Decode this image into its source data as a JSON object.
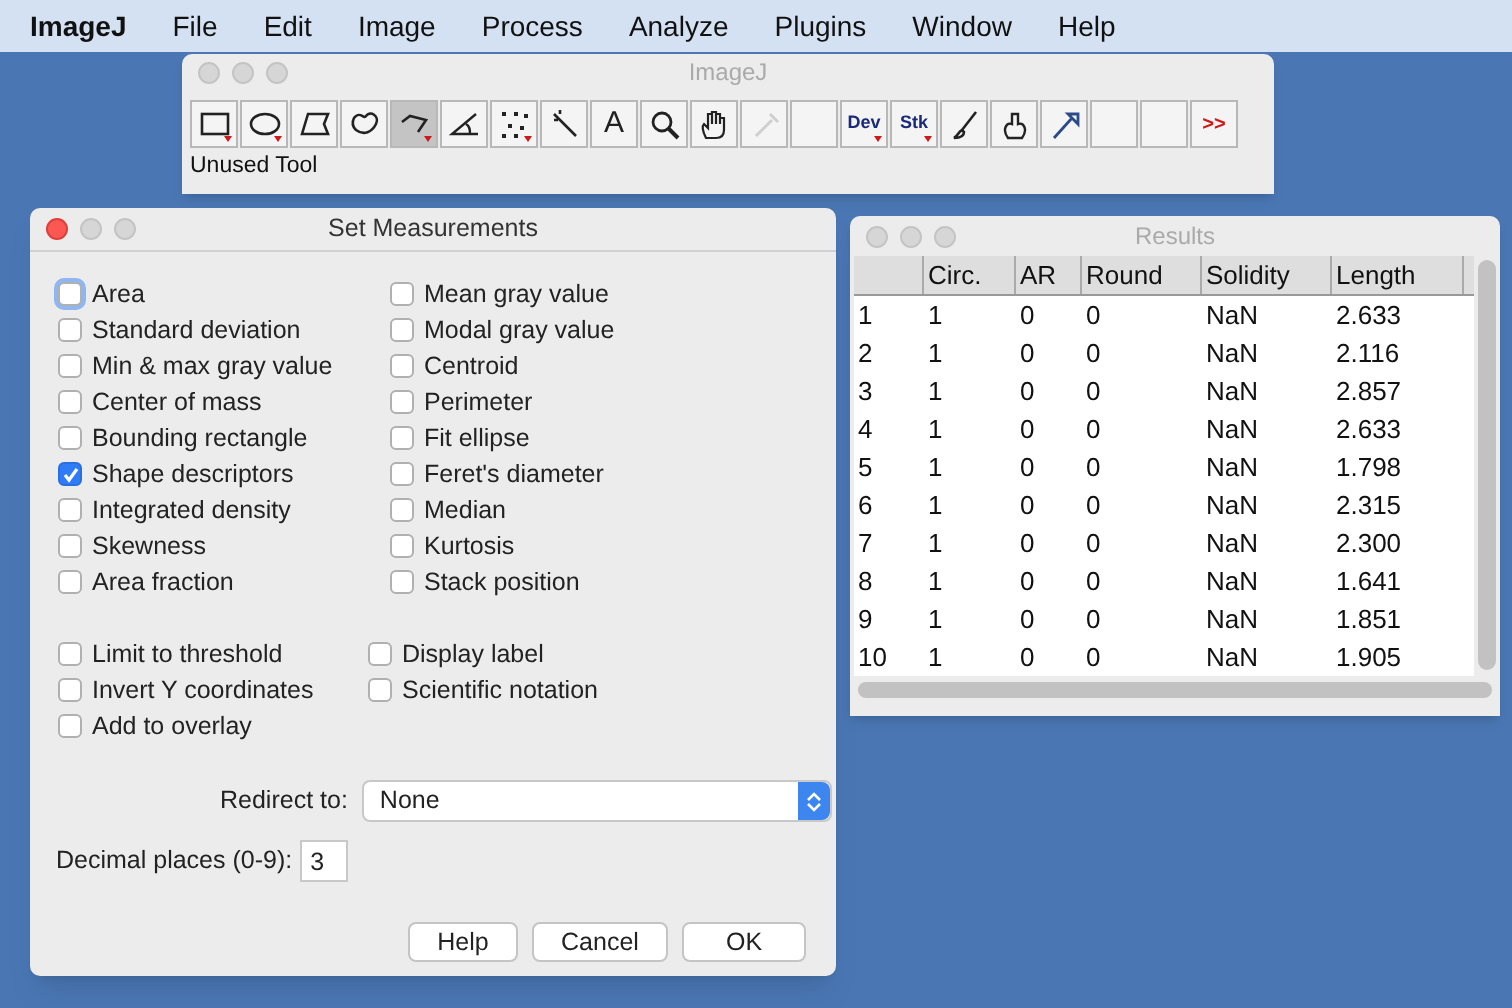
{
  "menu_bar": {
    "app": "ImageJ",
    "items": [
      "File",
      "Edit",
      "Image",
      "Process",
      "Analyze",
      "Plugins",
      "Window",
      "Help"
    ]
  },
  "toolbar_window": {
    "title": "ImageJ",
    "status": "Unused Tool",
    "tools": [
      {
        "kind": "rectangle",
        "selected": false,
        "has_menu": true
      },
      {
        "kind": "oval",
        "selected": false,
        "has_menu": true
      },
      {
        "kind": "polygon",
        "selected": false,
        "has_menu": false
      },
      {
        "kind": "freehand",
        "selected": false,
        "has_menu": false
      },
      {
        "kind": "polyline",
        "selected": true,
        "has_menu": true
      },
      {
        "kind": "angle",
        "selected": false,
        "has_menu": false
      },
      {
        "kind": "points",
        "selected": false,
        "has_menu": true
      },
      {
        "kind": "wand",
        "selected": false,
        "has_menu": false
      },
      {
        "kind": "label",
        "label": "A",
        "selected": false,
        "has_menu": false
      },
      {
        "kind": "magnifier",
        "selected": false,
        "has_menu": false
      },
      {
        "kind": "hand",
        "selected": false,
        "has_menu": false
      },
      {
        "kind": "picker",
        "selected": false,
        "has_menu": false
      },
      {
        "kind": "empty",
        "selected": false,
        "has_menu": false
      },
      {
        "kind": "label",
        "label": "Dev",
        "selected": false,
        "has_menu": true
      },
      {
        "kind": "label",
        "label": "Stk",
        "selected": false,
        "has_menu": true
      },
      {
        "kind": "brush",
        "selected": false,
        "has_menu": false
      },
      {
        "kind": "blob",
        "selected": false,
        "has_menu": false
      },
      {
        "kind": "pen",
        "selected": false,
        "has_menu": false
      },
      {
        "kind": "empty",
        "selected": false,
        "has_menu": false
      },
      {
        "kind": "empty",
        "selected": false,
        "has_menu": false
      },
      {
        "kind": "more",
        "label": ">>",
        "selected": false,
        "has_menu": false
      }
    ]
  },
  "dialog": {
    "title": "Set Measurements",
    "left": [
      {
        "label": "Area",
        "checked": false,
        "focused": true
      },
      {
        "label": "Standard deviation",
        "checked": false,
        "focused": false
      },
      {
        "label": "Min & max gray value",
        "checked": false,
        "focused": false
      },
      {
        "label": "Center of mass",
        "checked": false,
        "focused": false
      },
      {
        "label": "Bounding rectangle",
        "checked": false,
        "focused": false
      },
      {
        "label": "Shape descriptors",
        "checked": true,
        "focused": false
      },
      {
        "label": "Integrated density",
        "checked": false,
        "focused": false
      },
      {
        "label": "Skewness",
        "checked": false,
        "focused": false
      },
      {
        "label": "Area fraction",
        "checked": false,
        "focused": false
      }
    ],
    "right": [
      {
        "label": "Mean gray value",
        "checked": false,
        "focused": false
      },
      {
        "label": "Modal gray value",
        "checked": false,
        "focused": false
      },
      {
        "label": "Centroid",
        "checked": false,
        "focused": false
      },
      {
        "label": "Perimeter",
        "checked": false,
        "focused": false
      },
      {
        "label": "Fit ellipse",
        "checked": false,
        "focused": false
      },
      {
        "label": "Feret's diameter",
        "checked": false,
        "focused": false
      },
      {
        "label": "Median",
        "checked": false,
        "focused": false
      },
      {
        "label": "Kurtosis",
        "checked": false,
        "focused": false
      },
      {
        "label": "Stack position",
        "checked": false,
        "focused": false
      }
    ],
    "options_left": [
      {
        "label": "Limit to threshold",
        "checked": false,
        "focused": false
      },
      {
        "label": "Invert Y coordinates",
        "checked": false,
        "focused": false
      },
      {
        "label": "Add to overlay",
        "checked": false,
        "focused": false
      }
    ],
    "options_right": [
      {
        "label": "Display label",
        "checked": false,
        "focused": false
      },
      {
        "label": "Scientific notation",
        "checked": false,
        "focused": false
      }
    ],
    "redirect": {
      "label": "Redirect to:",
      "value": "None"
    },
    "decimal": {
      "label": "Decimal places (0-9):",
      "value": "3"
    },
    "buttons": [
      "Help",
      "Cancel",
      "OK"
    ]
  },
  "results": {
    "title": "Results",
    "columns": [
      "",
      "Circ.",
      "AR",
      "Round",
      "Solidity",
      "Length"
    ],
    "rows": [
      [
        "1",
        "1",
        "0",
        "0",
        "NaN",
        "2.633"
      ],
      [
        "2",
        "1",
        "0",
        "0",
        "NaN",
        "2.116"
      ],
      [
        "3",
        "1",
        "0",
        "0",
        "NaN",
        "2.857"
      ],
      [
        "4",
        "1",
        "0",
        "0",
        "NaN",
        "2.633"
      ],
      [
        "5",
        "1",
        "0",
        "0",
        "NaN",
        "1.798"
      ],
      [
        "6",
        "1",
        "0",
        "0",
        "NaN",
        "2.315"
      ],
      [
        "7",
        "1",
        "0",
        "0",
        "NaN",
        "2.300"
      ],
      [
        "8",
        "1",
        "0",
        "0",
        "NaN",
        "1.641"
      ],
      [
        "9",
        "1",
        "0",
        "0",
        "NaN",
        "1.851"
      ],
      [
        "10",
        "1",
        "0",
        "0",
        "NaN",
        "1.905"
      ]
    ]
  }
}
